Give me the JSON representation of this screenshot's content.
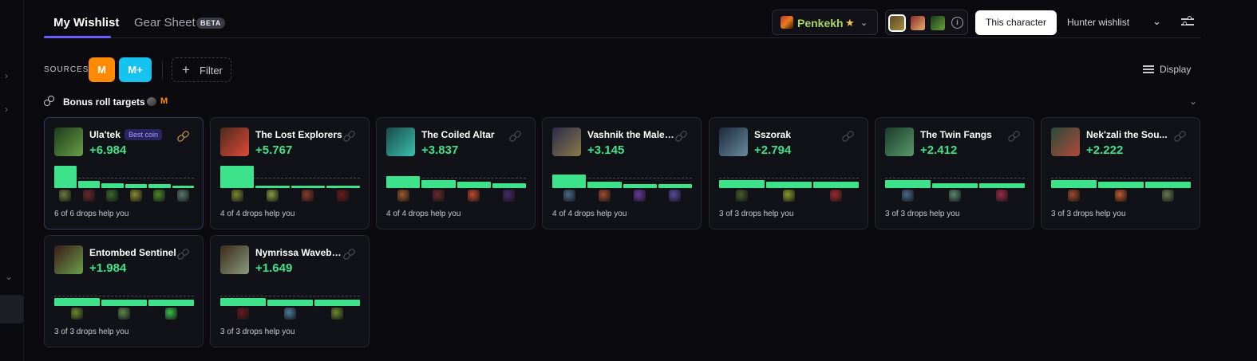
{
  "header": {
    "tabs": [
      {
        "label": "My Wishlist"
      },
      {
        "label": "Gear Sheet",
        "badge": "BETA"
      }
    ],
    "character": {
      "name": "Penkekh"
    },
    "this_character_label": "This character",
    "hunter_wishlist_label": "Hunter wishlist"
  },
  "sources": {
    "label": "SOURCES",
    "options": [
      {
        "label": "M",
        "color": "#ff8a00"
      },
      {
        "label": "M+",
        "color": "#14c3f0"
      }
    ],
    "filter_label": "Filter",
    "display_label": "Display"
  },
  "section": {
    "title": "Bonus roll targets",
    "tag": "M"
  },
  "cards": [
    {
      "name": "Ula'tek",
      "badge": "Best coin",
      "score": "+6.984",
      "drops": "6 of 6 drops help you",
      "bars": [
        1.0,
        0.32,
        0.22,
        0.18,
        0.18,
        0.08
      ],
      "item_colors": [
        "#6a7a3a",
        "#6a2a2a",
        "#3a6a2a",
        "#8a8a2a",
        "#4a8a2a",
        "#5a7a6a"
      ],
      "avatar": [
        "#1d3a1a",
        "#6aa04a"
      ]
    },
    {
      "name": "The Lost Explorers",
      "score": "+5.767",
      "drops": "4 of 4 drops help you",
      "bars": [
        1.0,
        0.12,
        0.12,
        0.12
      ],
      "item_colors": [
        "#7a8a2a",
        "#8a9a3a",
        "#8a3a2a",
        "#6a1a1a"
      ],
      "avatar": [
        "#4a2a1a",
        "#e04a3a"
      ]
    },
    {
      "name": "The Coiled Altar",
      "score": "+3.837",
      "drops": "4 of 4 drops help you",
      "bars": [
        0.55,
        0.35,
        0.3,
        0.2
      ],
      "item_colors": [
        "#a05a2a",
        "#6a2a2a",
        "#c04a2a",
        "#4a2a6a"
      ],
      "avatar": [
        "#1a4a4a",
        "#3ac0b0"
      ]
    },
    {
      "name": "Vashnik the Malevolent",
      "score": "+3.145",
      "drops": "4 of 4 drops help you",
      "bars": [
        0.6,
        0.3,
        0.18,
        0.18
      ],
      "item_colors": [
        "#4a6a8a",
        "#a04a2a",
        "#6a3aa0",
        "#5a4a9a"
      ],
      "avatar": [
        "#2a2a4a",
        "#8a7a4a"
      ]
    },
    {
      "name": "Sszorak",
      "score": "+2.794",
      "drops": "3 of 3 drops help you",
      "bars": [
        0.35,
        0.3,
        0.3
      ],
      "item_colors": [
        "#4a5a2a",
        "#8a9a2a",
        "#a02a2a"
      ],
      "avatar": [
        "#1a2a3a",
        "#6a8aa0"
      ]
    },
    {
      "name": "The Twin Fangs",
      "score": "+2.412",
      "drops": "3 of 3 drops help you",
      "bars": [
        0.35,
        0.22,
        0.22
      ],
      "item_colors": [
        "#4a6a8a",
        "#5a8a6a",
        "#a02a4a"
      ],
      "avatar": [
        "#1a3a2a",
        "#5a9a6a"
      ]
    },
    {
      "name": "Nek'zali the Sou...",
      "score": "+2.222",
      "drops": "3 of 3 drops help you",
      "bars": [
        0.35,
        0.3,
        0.3
      ],
      "item_colors": [
        "#a04a2a",
        "#c05a2a",
        "#6a7a4a"
      ],
      "avatar": [
        "#2a4a3a",
        "#b04a3a"
      ]
    },
    {
      "name": "Entombed Sentinel",
      "score": "+1.984",
      "drops": "3 of 3 drops help you",
      "bars": [
        0.35,
        0.3,
        0.3
      ],
      "item_colors": [
        "#6a8a2a",
        "#5a8a4a",
        "#3ac04a"
      ],
      "avatar": [
        "#3a1a1a",
        "#6aa04a"
      ]
    },
    {
      "name": "Nymrissa Wavebreaker",
      "score": "+1.649",
      "drops": "3 of 3 drops help you",
      "bars": [
        0.35,
        0.3,
        0.3
      ],
      "item_colors": [
        "#6a1a1a",
        "#4a7a9a",
        "#6a8a2a"
      ],
      "avatar": [
        "#3a2a1a",
        "#8a9a7a"
      ]
    }
  ]
}
